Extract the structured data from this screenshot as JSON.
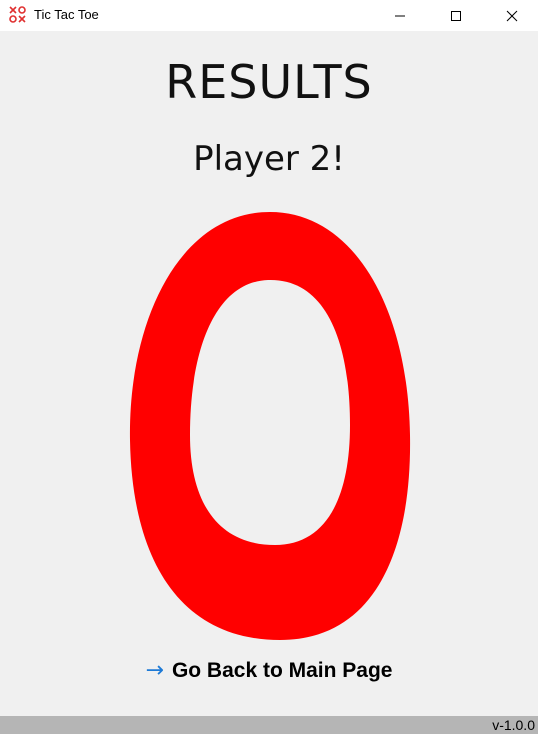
{
  "window": {
    "title": "Tic Tac Toe",
    "icon": "tic-tac-toe-app-icon"
  },
  "window_controls": {
    "minimize_icon": "minimize-icon",
    "maximize_icon": "maximize-icon",
    "close_icon": "close-icon"
  },
  "results": {
    "heading": "RESULTS",
    "winner_text": "Player 2!",
    "winner_symbol": "O",
    "winner_symbol_color": "#ff0000"
  },
  "navigation": {
    "back_arrow_icon": "arrow-right-icon",
    "back_arrow_glyph": "→",
    "back_label": "Go Back to Main Page",
    "accent_color": "#1e7ad6"
  },
  "statusbar": {
    "version": "v-1.0.0"
  }
}
